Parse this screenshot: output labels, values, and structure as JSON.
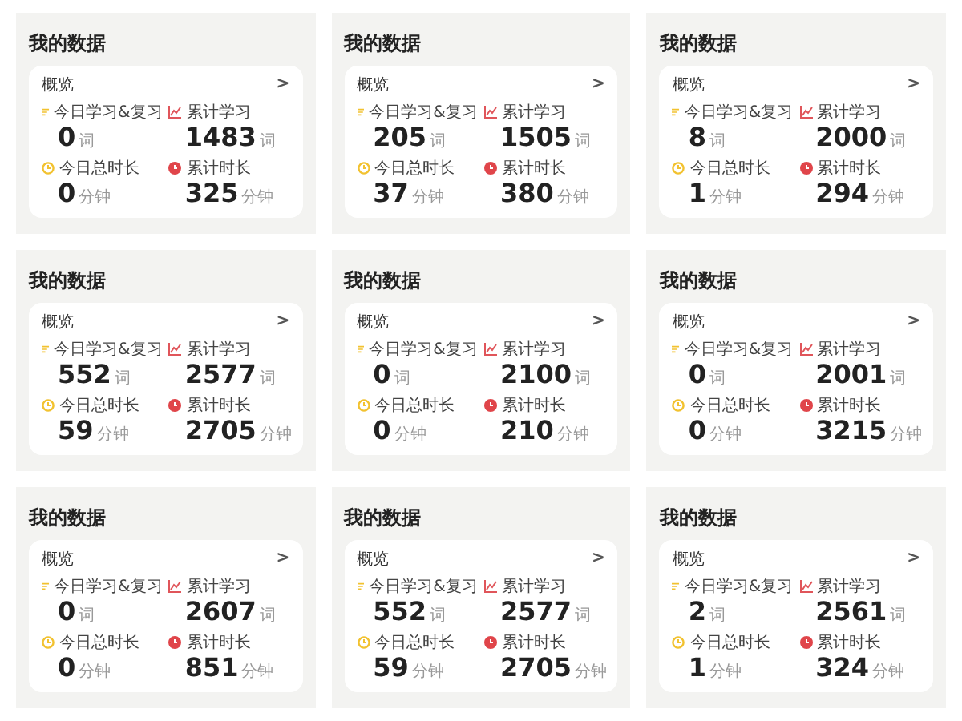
{
  "panels": [
    {
      "title": "我的数据",
      "card": {
        "label": "概览",
        "chevron": ">"
      },
      "stats": [
        {
          "kind": "list",
          "label": "今日学习&复习",
          "value": "0",
          "unit": "词"
        },
        {
          "kind": "trend",
          "label": "累计学习",
          "value": "1483",
          "unit": "词"
        },
        {
          "kind": "clock",
          "label": "今日总时长",
          "value": "0",
          "unit": "分钟"
        },
        {
          "kind": "alarm",
          "label": "累计时长",
          "value": "325",
          "unit": "分钟"
        }
      ]
    },
    {
      "title": "我的数据",
      "card": {
        "label": "概览",
        "chevron": ">"
      },
      "stats": [
        {
          "kind": "list",
          "label": "今日学习&复习",
          "value": "205",
          "unit": "词"
        },
        {
          "kind": "trend",
          "label": "累计学习",
          "value": "1505",
          "unit": "词"
        },
        {
          "kind": "clock",
          "label": "今日总时长",
          "value": "37",
          "unit": "分钟"
        },
        {
          "kind": "alarm",
          "label": "累计时长",
          "value": "380",
          "unit": "分钟"
        }
      ]
    },
    {
      "title": "我的数据",
      "card": {
        "label": "概览",
        "chevron": ">"
      },
      "stats": [
        {
          "kind": "list",
          "label": "今日学习&复习",
          "value": "8",
          "unit": "词"
        },
        {
          "kind": "trend",
          "label": "累计学习",
          "value": "2000",
          "unit": "词"
        },
        {
          "kind": "clock",
          "label": "今日总时长",
          "value": "1",
          "unit": "分钟"
        },
        {
          "kind": "alarm",
          "label": "累计时长",
          "value": "294",
          "unit": "分钟"
        }
      ]
    },
    {
      "title": "我的数据",
      "card": {
        "label": "概览",
        "chevron": ">"
      },
      "stats": [
        {
          "kind": "list",
          "label": "今日学习&复习",
          "value": "552",
          "unit": "词"
        },
        {
          "kind": "trend",
          "label": "累计学习",
          "value": "2577",
          "unit": "词"
        },
        {
          "kind": "clock",
          "label": "今日总时长",
          "value": "59",
          "unit": "分钟"
        },
        {
          "kind": "alarm",
          "label": "累计时长",
          "value": "2705",
          "unit": "分钟"
        }
      ]
    },
    {
      "title": "我的数据",
      "card": {
        "label": "概览",
        "chevron": ">"
      },
      "stats": [
        {
          "kind": "list",
          "label": "今日学习&复习",
          "value": "0",
          "unit": "词"
        },
        {
          "kind": "trend",
          "label": "累计学习",
          "value": "2100",
          "unit": "词"
        },
        {
          "kind": "clock",
          "label": "今日总时长",
          "value": "0",
          "unit": "分钟"
        },
        {
          "kind": "alarm",
          "label": "累计时长",
          "value": "210",
          "unit": "分钟"
        }
      ]
    },
    {
      "title": "我的数据",
      "card": {
        "label": "概览",
        "chevron": ">"
      },
      "stats": [
        {
          "kind": "list",
          "label": "今日学习&复习",
          "value": "0",
          "unit": "词"
        },
        {
          "kind": "trend",
          "label": "累计学习",
          "value": "2001",
          "unit": "词"
        },
        {
          "kind": "clock",
          "label": "今日总时长",
          "value": "0",
          "unit": "分钟"
        },
        {
          "kind": "alarm",
          "label": "累计时长",
          "value": "3215",
          "unit": "分钟"
        }
      ]
    },
    {
      "title": "我的数据",
      "card": {
        "label": "概览",
        "chevron": ">"
      },
      "stats": [
        {
          "kind": "list",
          "label": "今日学习&复习",
          "value": "0",
          "unit": "词"
        },
        {
          "kind": "trend",
          "label": "累计学习",
          "value": "2607",
          "unit": "词"
        },
        {
          "kind": "clock",
          "label": "今日总时长",
          "value": "0",
          "unit": "分钟"
        },
        {
          "kind": "alarm",
          "label": "累计时长",
          "value": "851",
          "unit": "分钟"
        }
      ]
    },
    {
      "title": "我的数据",
      "card": {
        "label": "概览",
        "chevron": ">"
      },
      "stats": [
        {
          "kind": "list",
          "label": "今日学习&复习",
          "value": "552",
          "unit": "词"
        },
        {
          "kind": "trend",
          "label": "累计学习",
          "value": "2577",
          "unit": "词"
        },
        {
          "kind": "clock",
          "label": "今日总时长",
          "value": "59",
          "unit": "分钟"
        },
        {
          "kind": "alarm",
          "label": "累计时长",
          "value": "2705",
          "unit": "分钟"
        }
      ]
    },
    {
      "title": "我的数据",
      "card": {
        "label": "概览",
        "chevron": ">"
      },
      "stats": [
        {
          "kind": "list",
          "label": "今日学习&复习",
          "value": "2",
          "unit": "词"
        },
        {
          "kind": "trend",
          "label": "累计学习",
          "value": "2561",
          "unit": "词"
        },
        {
          "kind": "clock",
          "label": "今日总时长",
          "value": "1",
          "unit": "分钟"
        },
        {
          "kind": "alarm",
          "label": "累计时长",
          "value": "324",
          "unit": "分钟"
        }
      ]
    }
  ]
}
